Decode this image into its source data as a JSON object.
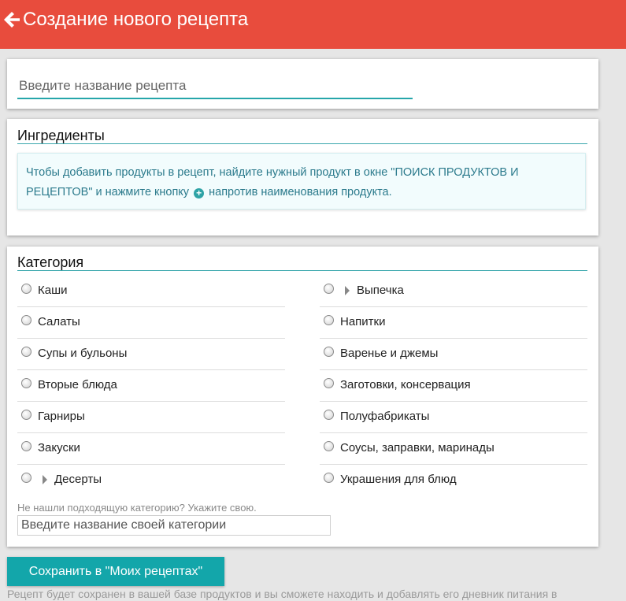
{
  "header": {
    "title": "Создание нового рецепта"
  },
  "recipe_name": {
    "placeholder": "Введите название рецепта",
    "value": ""
  },
  "ingredients": {
    "title": "Ингредиенты",
    "info_before_icon": "Чтобы добавить продукты в рецепт, найдите нужный продукт в окне \"ПОИСК ПРОДУКТОВ И РЕЦЕПТОВ\" и нажмите кнопку ",
    "info_after_icon": " напротив наименования продукта."
  },
  "category": {
    "title": "Категория",
    "left": [
      {
        "label": "Каши",
        "has_sub": false
      },
      {
        "label": "Салаты",
        "has_sub": false
      },
      {
        "label": "Супы и бульоны",
        "has_sub": false
      },
      {
        "label": "Вторые блюда",
        "has_sub": false
      },
      {
        "label": "Гарниры",
        "has_sub": false
      },
      {
        "label": "Закуски",
        "has_sub": false
      },
      {
        "label": "Десерты",
        "has_sub": true
      }
    ],
    "right": [
      {
        "label": "Выпечка",
        "has_sub": true
      },
      {
        "label": "Напитки",
        "has_sub": false
      },
      {
        "label": "Варенье и джемы",
        "has_sub": false
      },
      {
        "label": "Заготовки, консервация",
        "has_sub": false
      },
      {
        "label": "Полуфабрикаты",
        "has_sub": false
      },
      {
        "label": "Соусы, заправки, маринады",
        "has_sub": false
      },
      {
        "label": "Украшения для блюд",
        "has_sub": false
      }
    ],
    "hint": "Не нашли подходящую категорию? Укажите свою.",
    "own_placeholder": "Введите название своей категории"
  },
  "actions": {
    "save_label": "Сохранить в \"Моих рецептах\""
  },
  "footnote": "Рецепт будет сохранен в вашей базе продуктов и вы сможете находить и добавлять его дневник питания в",
  "colors": {
    "header_bg": "#e84c3d",
    "accent": "#13a6aa",
    "info_text": "#2b7a8c"
  },
  "icons": {
    "back": "arrow-left-icon",
    "add": "plus-circle-icon",
    "expand": "caret-right-icon"
  }
}
